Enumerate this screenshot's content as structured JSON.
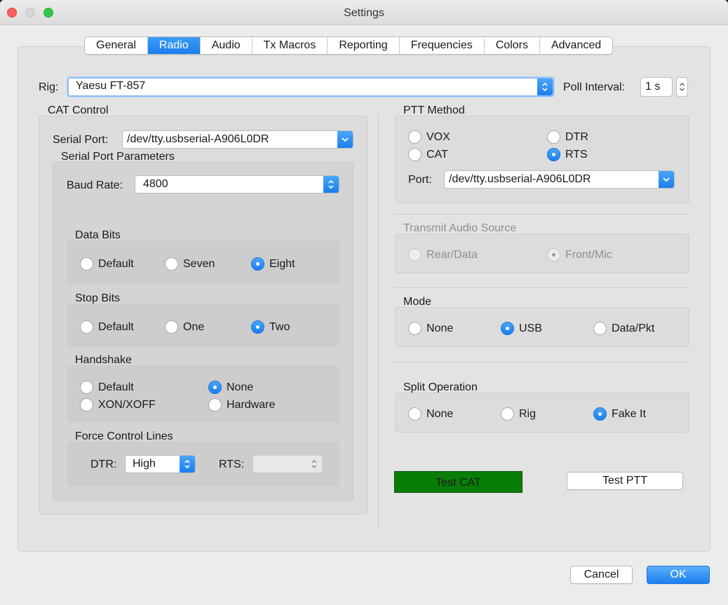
{
  "window": {
    "title": "Settings"
  },
  "tabs": [
    {
      "label": "General"
    },
    {
      "label": "Radio"
    },
    {
      "label": "Audio"
    },
    {
      "label": "Tx Macros"
    },
    {
      "label": "Reporting"
    },
    {
      "label": "Frequencies"
    },
    {
      "label": "Colors"
    },
    {
      "label": "Advanced"
    }
  ],
  "active_tab": "Radio",
  "rig": {
    "label": "Rig:",
    "value": "Yaesu FT-857"
  },
  "poll": {
    "label": "Poll Interval:",
    "value": "1 s"
  },
  "cat": {
    "title": "CAT Control",
    "serial_port_label": "Serial Port:",
    "serial_port_value": "/dev/tty.usbserial-A906L0DR",
    "params_title": "Serial Port Parameters",
    "baud_label": "Baud Rate:",
    "baud_value": "4800",
    "data_bits": {
      "title": "Data Bits",
      "options": [
        "Default",
        "Seven",
        "Eight"
      ],
      "selected": "Eight"
    },
    "stop_bits": {
      "title": "Stop Bits",
      "options": [
        "Default",
        "One",
        "Two"
      ],
      "selected": "Two"
    },
    "handshake": {
      "title": "Handshake",
      "options": [
        "Default",
        "None",
        "XON/XOFF",
        "Hardware"
      ],
      "selected": "None"
    },
    "force": {
      "title": "Force Control Lines",
      "dtr_label": "DTR:",
      "dtr_value": "High",
      "rts_label": "RTS:",
      "rts_value": ""
    }
  },
  "ptt": {
    "title": "PTT Method",
    "options": [
      "VOX",
      "DTR",
      "CAT",
      "RTS"
    ],
    "selected": "RTS",
    "port_label": "Port:",
    "port_value": "/dev/tty.usbserial-A906L0DR"
  },
  "tx_audio": {
    "title": "Transmit Audio Source",
    "options": [
      "Rear/Data",
      "Front/Mic"
    ],
    "selected": "Front/Mic",
    "enabled": false
  },
  "mode": {
    "title": "Mode",
    "options": [
      "None",
      "USB",
      "Data/Pkt"
    ],
    "selected": "USB"
  },
  "split": {
    "title": "Split Operation",
    "options": [
      "None",
      "Rig",
      "Fake It"
    ],
    "selected": "Fake It"
  },
  "buttons": {
    "test_cat": "Test CAT",
    "test_ptt": "Test PTT",
    "cancel": "Cancel",
    "ok": "OK"
  },
  "colors": {
    "accent": "#1b7ff0",
    "test_cat_bg": "#087d08"
  }
}
